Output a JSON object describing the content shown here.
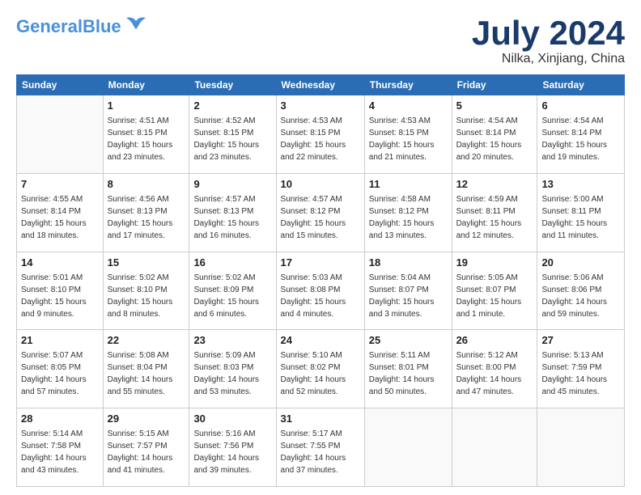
{
  "header": {
    "logo_line1": "General",
    "logo_line2": "Blue",
    "month": "July 2024",
    "location": "Nilka, Xinjiang, China"
  },
  "days_of_week": [
    "Sunday",
    "Monday",
    "Tuesday",
    "Wednesday",
    "Thursday",
    "Friday",
    "Saturday"
  ],
  "weeks": [
    [
      {
        "num": "",
        "info": ""
      },
      {
        "num": "1",
        "info": "Sunrise: 4:51 AM\nSunset: 8:15 PM\nDaylight: 15 hours\nand 23 minutes."
      },
      {
        "num": "2",
        "info": "Sunrise: 4:52 AM\nSunset: 8:15 PM\nDaylight: 15 hours\nand 23 minutes."
      },
      {
        "num": "3",
        "info": "Sunrise: 4:53 AM\nSunset: 8:15 PM\nDaylight: 15 hours\nand 22 minutes."
      },
      {
        "num": "4",
        "info": "Sunrise: 4:53 AM\nSunset: 8:15 PM\nDaylight: 15 hours\nand 21 minutes."
      },
      {
        "num": "5",
        "info": "Sunrise: 4:54 AM\nSunset: 8:14 PM\nDaylight: 15 hours\nand 20 minutes."
      },
      {
        "num": "6",
        "info": "Sunrise: 4:54 AM\nSunset: 8:14 PM\nDaylight: 15 hours\nand 19 minutes."
      }
    ],
    [
      {
        "num": "7",
        "info": "Sunrise: 4:55 AM\nSunset: 8:14 PM\nDaylight: 15 hours\nand 18 minutes."
      },
      {
        "num": "8",
        "info": "Sunrise: 4:56 AM\nSunset: 8:13 PM\nDaylight: 15 hours\nand 17 minutes."
      },
      {
        "num": "9",
        "info": "Sunrise: 4:57 AM\nSunset: 8:13 PM\nDaylight: 15 hours\nand 16 minutes."
      },
      {
        "num": "10",
        "info": "Sunrise: 4:57 AM\nSunset: 8:12 PM\nDaylight: 15 hours\nand 15 minutes."
      },
      {
        "num": "11",
        "info": "Sunrise: 4:58 AM\nSunset: 8:12 PM\nDaylight: 15 hours\nand 13 minutes."
      },
      {
        "num": "12",
        "info": "Sunrise: 4:59 AM\nSunset: 8:11 PM\nDaylight: 15 hours\nand 12 minutes."
      },
      {
        "num": "13",
        "info": "Sunrise: 5:00 AM\nSunset: 8:11 PM\nDaylight: 15 hours\nand 11 minutes."
      }
    ],
    [
      {
        "num": "14",
        "info": "Sunrise: 5:01 AM\nSunset: 8:10 PM\nDaylight: 15 hours\nand 9 minutes."
      },
      {
        "num": "15",
        "info": "Sunrise: 5:02 AM\nSunset: 8:10 PM\nDaylight: 15 hours\nand 8 minutes."
      },
      {
        "num": "16",
        "info": "Sunrise: 5:02 AM\nSunset: 8:09 PM\nDaylight: 15 hours\nand 6 minutes."
      },
      {
        "num": "17",
        "info": "Sunrise: 5:03 AM\nSunset: 8:08 PM\nDaylight: 15 hours\nand 4 minutes."
      },
      {
        "num": "18",
        "info": "Sunrise: 5:04 AM\nSunset: 8:07 PM\nDaylight: 15 hours\nand 3 minutes."
      },
      {
        "num": "19",
        "info": "Sunrise: 5:05 AM\nSunset: 8:07 PM\nDaylight: 15 hours\nand 1 minute."
      },
      {
        "num": "20",
        "info": "Sunrise: 5:06 AM\nSunset: 8:06 PM\nDaylight: 14 hours\nand 59 minutes."
      }
    ],
    [
      {
        "num": "21",
        "info": "Sunrise: 5:07 AM\nSunset: 8:05 PM\nDaylight: 14 hours\nand 57 minutes."
      },
      {
        "num": "22",
        "info": "Sunrise: 5:08 AM\nSunset: 8:04 PM\nDaylight: 14 hours\nand 55 minutes."
      },
      {
        "num": "23",
        "info": "Sunrise: 5:09 AM\nSunset: 8:03 PM\nDaylight: 14 hours\nand 53 minutes."
      },
      {
        "num": "24",
        "info": "Sunrise: 5:10 AM\nSunset: 8:02 PM\nDaylight: 14 hours\nand 52 minutes."
      },
      {
        "num": "25",
        "info": "Sunrise: 5:11 AM\nSunset: 8:01 PM\nDaylight: 14 hours\nand 50 minutes."
      },
      {
        "num": "26",
        "info": "Sunrise: 5:12 AM\nSunset: 8:00 PM\nDaylight: 14 hours\nand 47 minutes."
      },
      {
        "num": "27",
        "info": "Sunrise: 5:13 AM\nSunset: 7:59 PM\nDaylight: 14 hours\nand 45 minutes."
      }
    ],
    [
      {
        "num": "28",
        "info": "Sunrise: 5:14 AM\nSunset: 7:58 PM\nDaylight: 14 hours\nand 43 minutes."
      },
      {
        "num": "29",
        "info": "Sunrise: 5:15 AM\nSunset: 7:57 PM\nDaylight: 14 hours\nand 41 minutes."
      },
      {
        "num": "30",
        "info": "Sunrise: 5:16 AM\nSunset: 7:56 PM\nDaylight: 14 hours\nand 39 minutes."
      },
      {
        "num": "31",
        "info": "Sunrise: 5:17 AM\nSunset: 7:55 PM\nDaylight: 14 hours\nand 37 minutes."
      },
      {
        "num": "",
        "info": ""
      },
      {
        "num": "",
        "info": ""
      },
      {
        "num": "",
        "info": ""
      }
    ]
  ]
}
